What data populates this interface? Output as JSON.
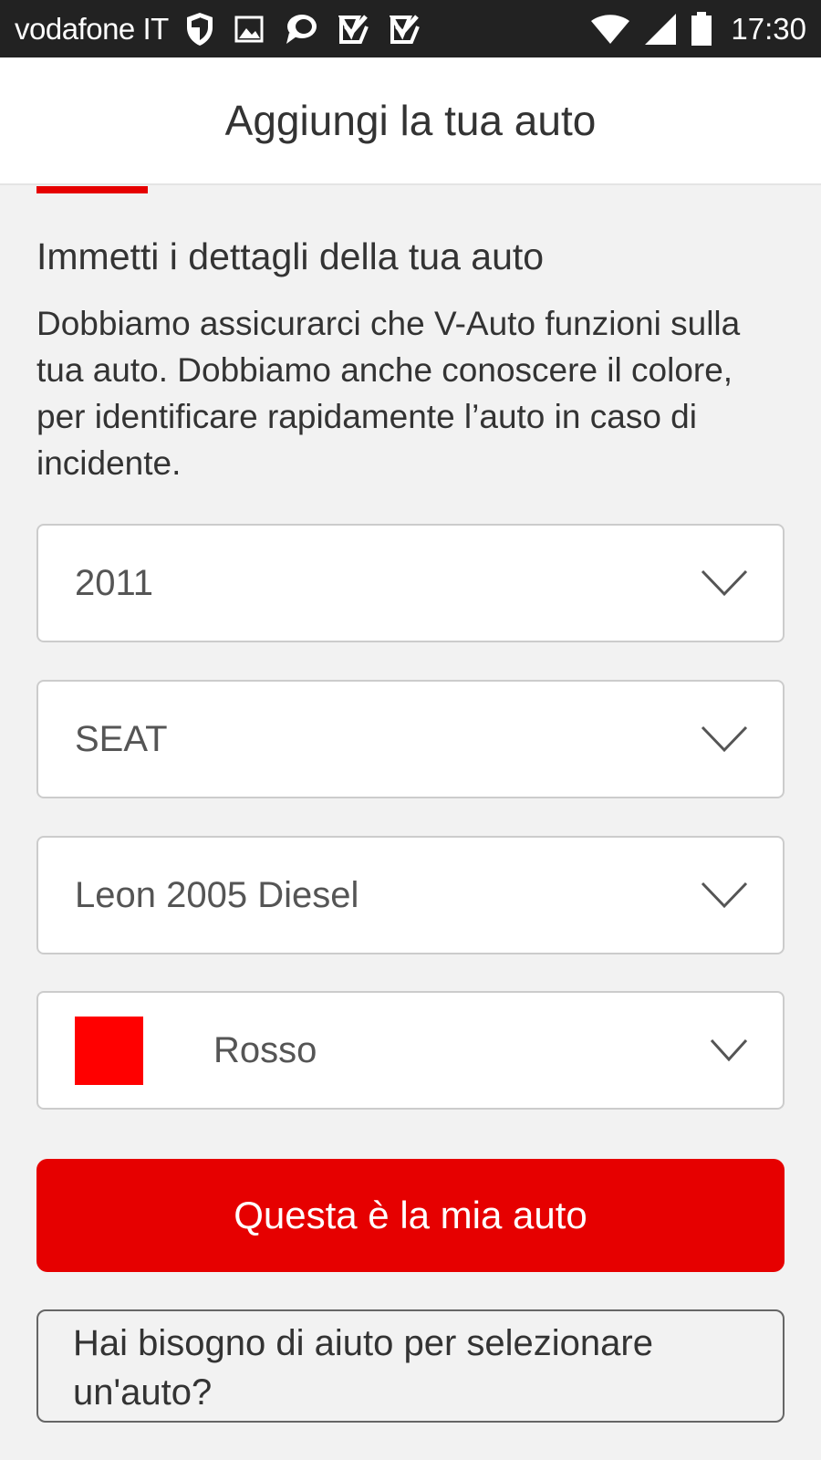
{
  "status_bar": {
    "carrier": "vodafone IT",
    "time": "17:30",
    "notification_icons": [
      "shield-icon",
      "image-icon",
      "chat-bubble-icon",
      "check-box-icon",
      "check-box-icon"
    ],
    "system_icons": [
      "wifi-icon",
      "signal-icon",
      "battery-icon"
    ]
  },
  "header": {
    "title": "Aggiungi la tua auto"
  },
  "form": {
    "title": "Immetti i dettagli della tua auto",
    "description": "Dobbiamo assicurarci che V-Auto funzioni sulla tua auto. Dobbiamo anche conoscere il colore, per identificare rapidamente l’auto in caso di incidente.",
    "year": "2011",
    "brand": "SEAT",
    "model": "Leon 2005 Diesel",
    "colour": {
      "label": "Rosso",
      "swatch": "#ff0000"
    }
  },
  "actions": {
    "confirm_label": "Questa è la mia auto",
    "help_label": "Hai bisogno di aiuto per selezionare un'auto?"
  },
  "theme": {
    "accent": "#e60000",
    "status_bar_bg": "#222222",
    "page_bg": "#f2f2f2"
  }
}
